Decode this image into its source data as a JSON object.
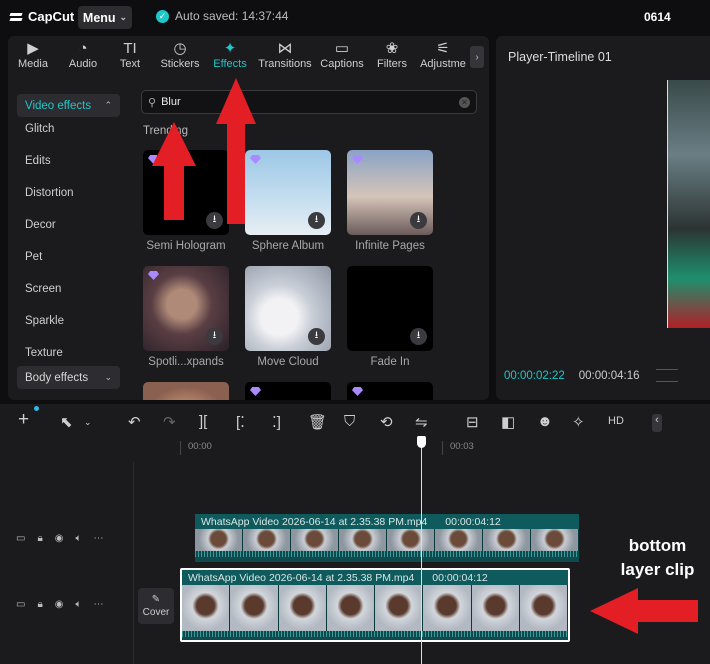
{
  "titlebar": {
    "app_name": "CapCut",
    "menu_label": "Menu",
    "autosave": "Auto saved: 14:37:44",
    "project": "0614"
  },
  "tabs": [
    {
      "label": "Media",
      "icon": "media-icon"
    },
    {
      "label": "Audio",
      "icon": "audio-icon"
    },
    {
      "label": "Text",
      "icon": "text-icon",
      "glyph": "TI"
    },
    {
      "label": "Stickers",
      "icon": "stickers-icon"
    },
    {
      "label": "Effects",
      "icon": "effects-icon",
      "active": true
    },
    {
      "label": "Transitions",
      "icon": "transitions-icon"
    },
    {
      "label": "Captions",
      "icon": "captions-icon"
    },
    {
      "label": "Filters",
      "icon": "filters-icon"
    },
    {
      "label": "Adjustme",
      "icon": "adjust-icon"
    }
  ],
  "sidebar": {
    "video_effects": "Video effects",
    "items": [
      "Glitch",
      "Edits",
      "Distortion",
      "Decor",
      "Pet",
      "Screen",
      "Sparkle",
      "Texture"
    ],
    "body_effects": "Body effects"
  },
  "search": {
    "value": "Blur"
  },
  "trending_label": "Trending",
  "effects": [
    {
      "label": "Semi Hologram"
    },
    {
      "label": "Sphere Album"
    },
    {
      "label": "Infinite Pages"
    },
    {
      "label": "Spotli...xpands"
    },
    {
      "label": "Move Cloud"
    },
    {
      "label": "Fade In"
    }
  ],
  "player": {
    "title": "Player-Timeline 01",
    "current_time": "00:00:02:22",
    "total_time": "00:00:04:16"
  },
  "timeline": {
    "ruler": [
      "00:00",
      "00:03"
    ],
    "clips": [
      {
        "name": "WhatsApp Video 2026-06-14 at 2.35.38 PM.mp4",
        "duration": "00:00:04:12"
      },
      {
        "name": "WhatsApp Video 2026-06-14 at 2.35.38 PM.mp4",
        "duration": "00:00:04:12"
      }
    ],
    "cover_label": "Cover"
  },
  "annotation": {
    "line1": "bottom",
    "line2": "layer clip",
    "arrow_color": "#e31e24"
  },
  "colors": {
    "accent": "#1fc7c9",
    "clip": "#0f4a4e"
  }
}
